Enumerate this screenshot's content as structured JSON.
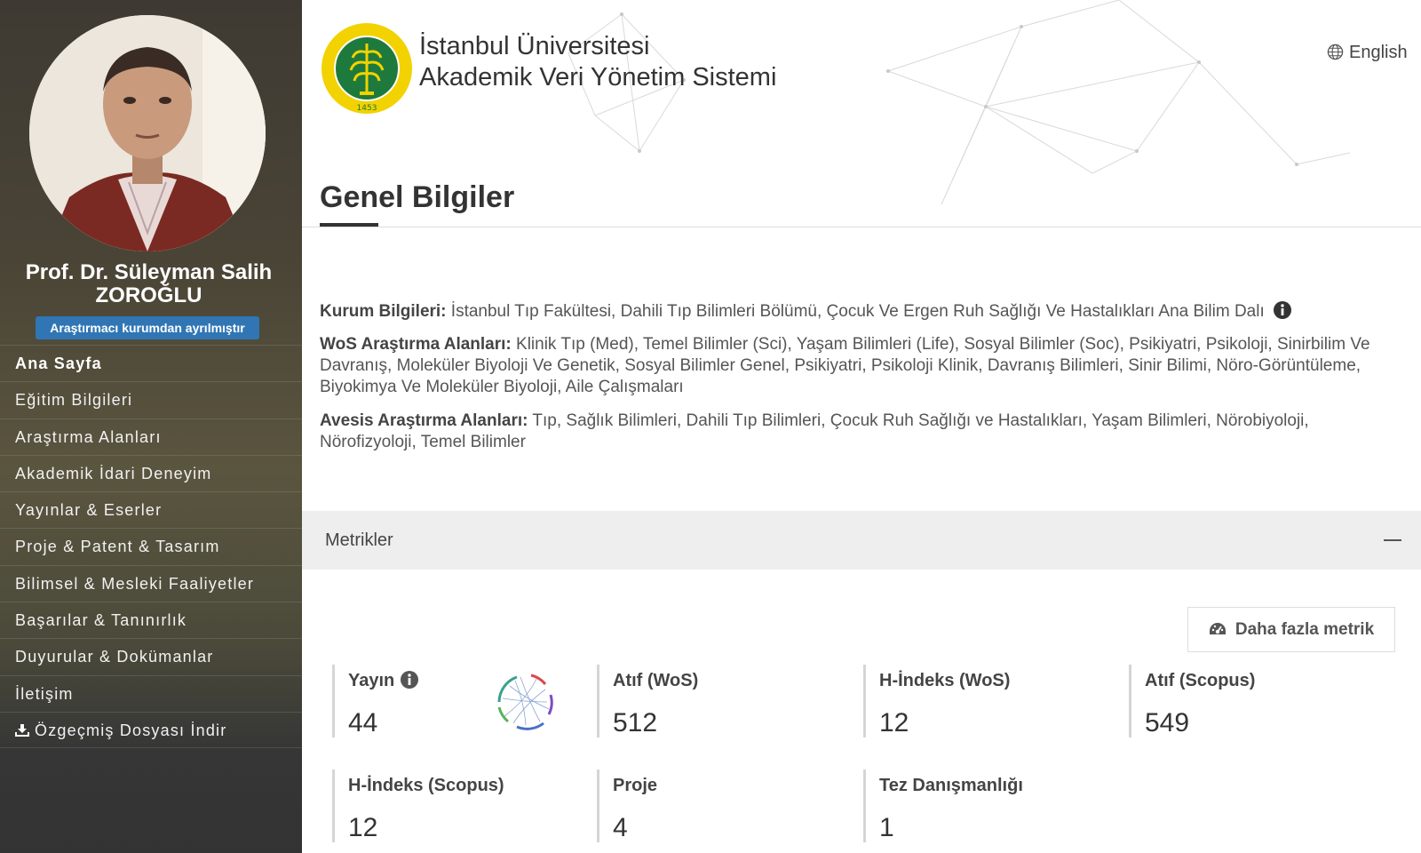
{
  "sidebar": {
    "name": "Prof. Dr. Süleyman Salih ZOROĞLU",
    "status": "Araştırmacı kurumdan ayrılmıştır",
    "nav": [
      {
        "label": "Ana Sayfa"
      },
      {
        "label": "Eğitim Bilgileri"
      },
      {
        "label": "Araştırma Alanları"
      },
      {
        "label": "Akademik İdari Deneyim"
      },
      {
        "label": "Yayınlar & Eserler"
      },
      {
        "label": "Proje & Patent & Tasarım"
      },
      {
        "label": "Bilimsel & Mesleki Faaliyetler"
      },
      {
        "label": "Başarılar & Tanınırlık"
      },
      {
        "label": "Duyurular & Dokümanlar"
      },
      {
        "label": "İletişim"
      },
      {
        "label": "Özgeçmiş Dosyası İndir"
      }
    ]
  },
  "header": {
    "brand_line1": "İstanbul Üniversitesi",
    "brand_line2": "Akademik Veri Yönetim Sistemi",
    "logo_ring_text": "T.C. İSTANBUL ÜNİVERSİTESİ",
    "logo_year": "1453",
    "language": "English",
    "page_title": "Genel Bilgiler"
  },
  "info": {
    "institution_label": "Kurum Bilgileri:",
    "institution_value": "İstanbul Tıp Fakültesi, Dahili Tıp Bilimleri Bölümü, Çocuk Ve Ergen Ruh Sağlığı Ve Hastalıkları Ana Bilim Dalı",
    "wos_label": "WoS Araştırma Alanları:",
    "wos_value": "Klinik Tıp (Med), Temel Bilimler (Sci), Yaşam Bilimleri (Life), Sosyal Bilimler (Soc), Psikiyatri, Psikoloji, Sinirbilim Ve Davranış, Moleküler Biyoloji Ve Genetik, Sosyal Bilimler Genel, Psikiyatri, Psikoloji Klinik, Davranış Bilimleri, Sinir Bilimi, Nöro-Görüntüleme, Biyokimya Ve Moleküler Biyoloji, Aile Çalışmaları",
    "avesis_label": "Avesis Araştırma Alanları:",
    "avesis_value": "Tıp, Sağlık Bilimleri, Dahili Tıp Bilimleri, Çocuk Ruh Sağlığı ve Hastalıkları, Yaşam Bilimleri, Nörobiyoloji, Nörofizyoloji, Temel Bilimler"
  },
  "metrics": {
    "title": "Metrikler",
    "more_button": "Daha fazla metrik",
    "items": [
      {
        "label": "Yayın",
        "value": "44"
      },
      {
        "label": "Atıf (WoS)",
        "value": "512"
      },
      {
        "label": "H-İndeks (WoS)",
        "value": "12"
      },
      {
        "label": "Atıf (Scopus)",
        "value": "549"
      },
      {
        "label": "H-İndeks (Scopus)",
        "value": "12"
      },
      {
        "label": "Proje",
        "value": "4"
      },
      {
        "label": "Tez Danışmanlığı",
        "value": "1"
      }
    ]
  },
  "colors": {
    "sidebar_dark": "#333333",
    "badge_blue": "#3076b5",
    "logo_green": "#1e7a3c",
    "logo_yellow": "#f2d200"
  },
  "icons": [
    "globe-icon",
    "info-icon",
    "download-icon",
    "dashboard-icon",
    "minus-icon"
  ]
}
